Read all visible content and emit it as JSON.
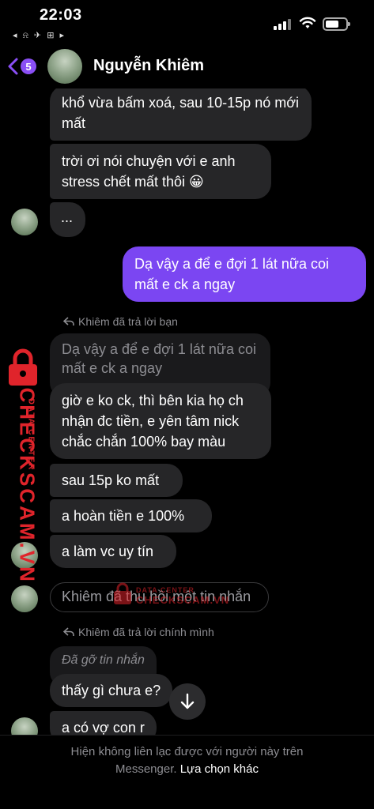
{
  "status_bar": {
    "time": "22:03",
    "left_icons": "◂ ⍾ ✈ ⊞ ▸",
    "icons": [
      "signal-icon",
      "wifi-icon",
      "battery-icon"
    ]
  },
  "header": {
    "back_icon": "chevron-left-icon",
    "unread_count": "5",
    "contact_name": "Nguyễn Khiêm"
  },
  "messages": {
    "m1": "khổ vừa bấm xoá, sau 10-15p nó mới mất",
    "m2": "trời ơi nói chuyện với e anh stress chết mất thôi 😀",
    "m3": "...",
    "m4_outgoing": "Dạ vậy a để e đợi 1 lát nữa coi mất e ck a ngay",
    "reply_label_1": "Khiêm đã trả lời bạn",
    "quoted_1": "Dạ vậy a để e đợi 1 lát nữa coi mất e ck a ngay",
    "m5": "giờ e ko ck, thì bên kia họ ch nhận đc tiền, e yên tâm nick chắc chắn 100% bay màu",
    "m6": "sau 15p ko mất",
    "m7": "a hoàn tiền e 100%",
    "m8": "a làm vc uy tín",
    "unsent_notice": "Khiêm đã thu hồi một tin nhắn",
    "reply_label_2": "Khiêm đã trả lời chính mình",
    "removed_quote": "Đã gỡ tin nhắn",
    "m9": "thấy gì chưa e?",
    "m10": "a có vợ con r"
  },
  "watermark": {
    "side_brand": "CHECKSCAM.VN",
    "side_sub": "DATA CENTER",
    "center_top": "DATA CENTER",
    "center_bottom": "CHECKSCAM.VN"
  },
  "footer": {
    "line1": "Hiện không liên lạc được với người này trên",
    "line2_prefix": "Messenger.",
    "line2_link": "Lựa chọn khác"
  },
  "colors": {
    "outgoing_bubble": "#7b46f2",
    "incoming_bubble": "#262628",
    "badge": "#8a4ff5",
    "watermark_red": "#e0242b"
  }
}
